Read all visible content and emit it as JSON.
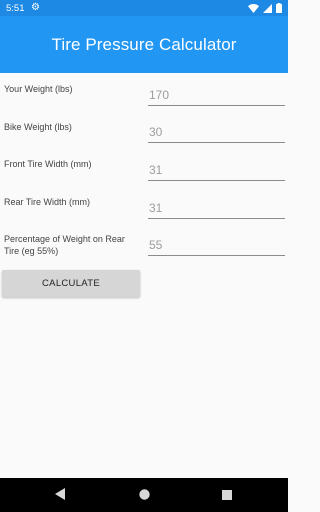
{
  "status_bar": {
    "time": "5:51",
    "icons": [
      "gear-icon",
      "wifi-icon",
      "signal-icon",
      "battery-icon"
    ]
  },
  "app_bar": {
    "title": "Tire Pressure Calculator",
    "color": "#2196f3"
  },
  "form": {
    "fields": [
      {
        "label": "Your Weight (lbs)",
        "value": "170"
      },
      {
        "label": "Bike Weight (lbs)",
        "value": "30"
      },
      {
        "label": "Front Tire Width (mm)",
        "value": "31"
      },
      {
        "label": "Rear Tire Width (mm)",
        "value": "31"
      },
      {
        "label": "Percentage of Weight on Rear Tire (eg 55%)",
        "value": "55"
      }
    ],
    "calculate_label": "CALCULATE"
  },
  "nav_bar": {
    "icons": [
      "back-icon",
      "home-icon",
      "recents-icon"
    ]
  }
}
